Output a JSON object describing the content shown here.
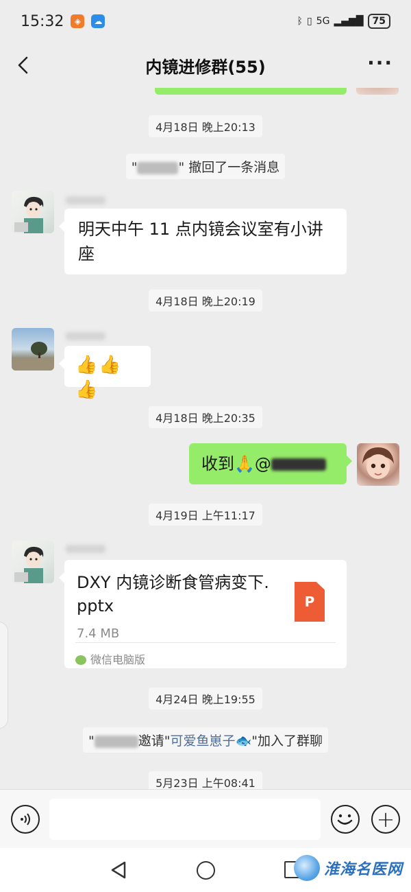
{
  "status_bar": {
    "time": "15:32",
    "network": "5G",
    "battery": "75",
    "icons": [
      "orange-app-icon",
      "cloud-app-icon",
      "bluetooth-icon",
      "vibrate-icon",
      "signal-icon"
    ]
  },
  "header": {
    "title": "内镜进修群(55)",
    "back_icon": "chevron-left-icon",
    "more_label": "···"
  },
  "messages": [
    {
      "type": "timestamp",
      "text": "4月18日 晚上20:13"
    },
    {
      "type": "system",
      "prefix": "\"",
      "suffix": "\" 撤回了一条消息"
    },
    {
      "type": "text",
      "side": "left",
      "text": "明天中午 11 点内镜会议室有小讲座"
    },
    {
      "type": "timestamp",
      "text": "4月18日 晚上20:19"
    },
    {
      "type": "emoji",
      "side": "left",
      "text": "👍👍👍"
    },
    {
      "type": "timestamp",
      "text": "4月18日 晚上20:35"
    },
    {
      "type": "text",
      "side": "right",
      "text": "收到🙏@"
    },
    {
      "type": "timestamp",
      "text": "4月19日 上午11:17"
    },
    {
      "type": "file",
      "side": "left",
      "file_name": "DXY 内镜诊断食管病变下.pptx",
      "file_size": "7.4 MB",
      "file_icon_label": "P",
      "source": "微信电脑版"
    },
    {
      "type": "timestamp",
      "text": "4月24日 晚上19:55"
    },
    {
      "type": "system",
      "prefix": "\"",
      "middle": "邀请\"",
      "link": "可爱鱼崽子🐟",
      "suffix": "\"加入了群聊"
    },
    {
      "type": "timestamp",
      "text": "5月23日 上午08:41"
    }
  ],
  "input_bar": {
    "voice_icon": "voice-icon",
    "emoji_icon": "emoji-icon",
    "plus_icon": "plus-icon",
    "plus_label": "+"
  },
  "watermark": {
    "text": "淮海名医网"
  },
  "colors": {
    "background": "#ededed",
    "bubble_self": "#95ec69",
    "bubble_other": "#ffffff",
    "file_icon": "#ee5c35",
    "link": "#4f6d99"
  }
}
